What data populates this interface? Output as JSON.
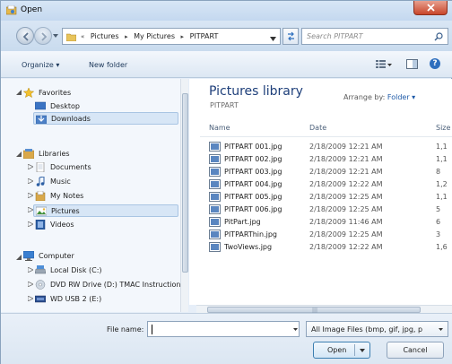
{
  "window": {
    "title": "Open"
  },
  "address": {
    "crumbs": [
      "«",
      "Pictures",
      "▸",
      "My Pictures",
      "▸",
      "PITPART"
    ],
    "search_placeholder": "Search PITPART"
  },
  "toolbar": {
    "organize": "Organize ▾",
    "new_folder": "New folder"
  },
  "nav": {
    "favorites": "Favorites",
    "desktop": "Desktop",
    "downloads": "Downloads",
    "libraries": "Libraries",
    "documents": "Documents",
    "music": "Music",
    "my_notes": "My Notes",
    "pictures": "Pictures",
    "videos": "Videos",
    "computer": "Computer",
    "local_disk": "Local Disk (C:)",
    "dvd": "DVD RW Drive (D:) TMAC Instruction",
    "usb": "WD USB 2 (E:)"
  },
  "library": {
    "title": "Pictures library",
    "subtitle": "PITPART",
    "arrange_label": "Arrange by:",
    "arrange_value": "Folder ▾"
  },
  "columns": {
    "name": "Name",
    "date": "Date",
    "size": "Size"
  },
  "files": [
    {
      "name": "PITPART 001.jpg",
      "date": "2/18/2009 12:21 AM",
      "size": "1,1"
    },
    {
      "name": "PITPART 002.jpg",
      "date": "2/18/2009 12:21 AM",
      "size": "1,1"
    },
    {
      "name": "PITPART 003.jpg",
      "date": "2/18/2009 12:21 AM",
      "size": "8"
    },
    {
      "name": "PITPART 004.jpg",
      "date": "2/18/2009 12:22 AM",
      "size": "1,2"
    },
    {
      "name": "PITPART 005.jpg",
      "date": "2/18/2009 12:25 AM",
      "size": "1,1"
    },
    {
      "name": "PITPART 006.jpg",
      "date": "2/18/2009 12:25 AM",
      "size": "5"
    },
    {
      "name": "PitPart.jpg",
      "date": "2/18/2009 11:46 AM",
      "size": "6"
    },
    {
      "name": "PITPARThin.jpg",
      "date": "2/18/2009 12:25 AM",
      "size": "3"
    },
    {
      "name": "TwoViews.jpg",
      "date": "2/18/2009 12:22 AM",
      "size": "1,6"
    }
  ],
  "bottom": {
    "file_name_label": "File name:",
    "file_name_value": "",
    "filter": "All Image Files (bmp, gif, jpg, p",
    "open": "Open",
    "cancel": "Cancel"
  },
  "colors": {
    "accent": "#1e3f7a",
    "selection": "#d7e6f6",
    "chrome": "#dce7f3"
  }
}
